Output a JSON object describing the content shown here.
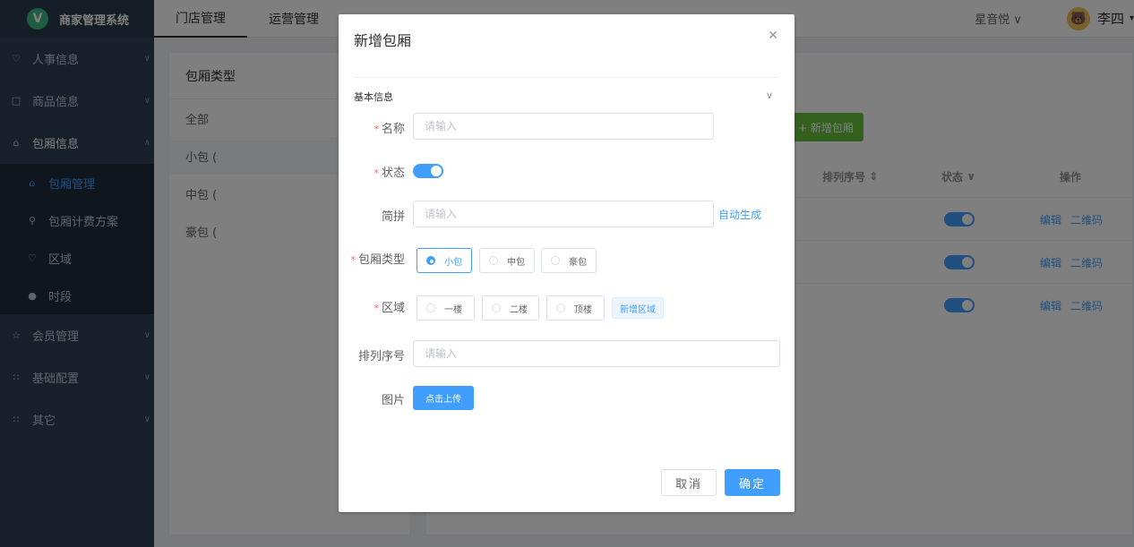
{
  "app": {
    "logo_letter": "V",
    "title": "商家管理系统"
  },
  "sidebar": {
    "items": [
      {
        "label": "人事信息",
        "icon": "person-icon"
      },
      {
        "label": "商品信息",
        "icon": "box-icon"
      },
      {
        "label": "包厢信息",
        "icon": "house-icon"
      },
      {
        "label": "会员管理",
        "icon": "star-icon"
      },
      {
        "label": "基础配置",
        "icon": "grid-icon"
      },
      {
        "label": "其它",
        "icon": "grid-icon"
      }
    ],
    "sub_items": [
      {
        "label": "包厢管理",
        "icon": "house-icon"
      },
      {
        "label": "包厢计费方案",
        "icon": "pin-icon"
      },
      {
        "label": "区域",
        "icon": "person-icon"
      },
      {
        "label": "时段",
        "icon": "clock-icon"
      }
    ]
  },
  "topbar": {
    "tabs": [
      "门店管理",
      "运营管理"
    ],
    "store": "星音悦",
    "username": "李四"
  },
  "background": {
    "type_panel_title": "包厢类型",
    "types": [
      "全部",
      "小包 (",
      "中包 (",
      "豪包 ("
    ],
    "add_room_button": "+ 新增包厢",
    "columns": {
      "sort": "排列序号",
      "status": "状态",
      "ops": "操作"
    },
    "row_ops": {
      "edit": "编辑",
      "qrcode": "二维码"
    }
  },
  "dialog": {
    "title": "新增包厢",
    "section": "基本信息",
    "fields": {
      "name": {
        "label": "名称",
        "placeholder": "请输入"
      },
      "status": {
        "label": "状态",
        "value": true
      },
      "pinyin": {
        "label": "简拼",
        "placeholder": "请输入",
        "auto": "自动生成"
      },
      "room_type": {
        "label": "包厢类型",
        "options": [
          "小包",
          "中包",
          "豪包"
        ],
        "selected": "小包"
      },
      "area": {
        "label": "区域",
        "options": [
          "一楼",
          "二楼",
          "顶楼"
        ],
        "add": "新增区域"
      },
      "sort": {
        "label": "排列序号",
        "placeholder": "请输入"
      },
      "image": {
        "label": "图片",
        "upload": "点击上传"
      }
    },
    "cancel": "取消",
    "confirm": "确定"
  },
  "colors": {
    "primary": "#409eff",
    "sidebar": "#304156",
    "success": "#67c23a",
    "danger": "#f56c6c"
  }
}
